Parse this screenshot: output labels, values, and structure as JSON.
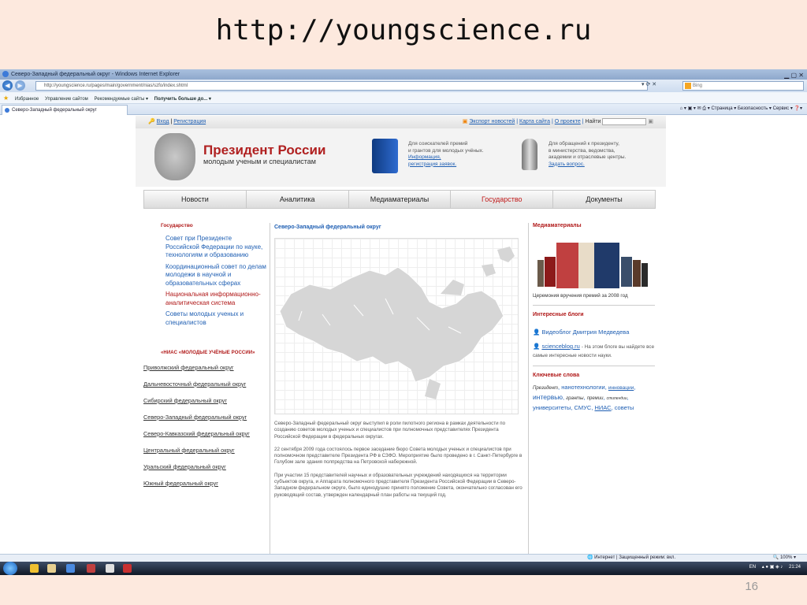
{
  "slide": {
    "title": "http://youngscience.ru",
    "number": "16"
  },
  "browser": {
    "window_title": "Северо-Западный федеральный округ - Windows Internet Explorer",
    "url": "http://youngscience.ru/pages/main/government/nias/szfo/index.shtml",
    "search_placeholder": "Bing",
    "favorites": [
      "Избранное",
      "Управление сайтом",
      "Рекомендуемые сайты ▾",
      "Получить больше до... ▾"
    ],
    "tab_label": "Северо-Западный федеральный округ",
    "commands": [
      "Страница ▾",
      "Безопасность ▾",
      "Сервис ▾"
    ],
    "status": "Интернет | Защищенный режим: вкл.",
    "zoom": "100%"
  },
  "site": {
    "topbar": {
      "login": "Вход",
      "register": "Регистрация",
      "news_export": "Экспорт новостей",
      "sitemap": "Карта сайта",
      "about": "О проекте",
      "find": "Найти"
    },
    "brand": "Президент России",
    "brand_sub": "молодым ученым и специалистам",
    "promo1": [
      "Для соискателей премий",
      "и грантов для молодых учёных."
    ],
    "promo1_links": [
      "Информация,",
      "регистрация заявок."
    ],
    "promo2": [
      "Для обращений к президенту,",
      "в министерства, ведомства,",
      "академии и отраслевые центры."
    ],
    "promo2_link": "Задать вопрос.",
    "menu": [
      "Новости",
      "Аналитика",
      "Медиаматериалы",
      "Государство",
      "Документы"
    ],
    "left": {
      "section": "Государство",
      "subs": [
        "Совет при Президенте Российской Федерации по науке, технологиям и образованию",
        "Координационный совет по делам молодежи в научной и образовательных сферах",
        "Национальная информационно-аналитическая система",
        "Советы молодых ученых и специалистов"
      ],
      "nias": "«НИАС «МОЛОДЫЕ УЧЁНЫЕ РОССИИ»",
      "okrugs": [
        "Приволжский федеральный округ",
        "Дальневосточный федеральный округ",
        "Сибирский федеральный округ",
        "Северо-Западный федеральный округ",
        "Северо-Кавказский федеральный округ",
        "Центральный федеральный округ",
        "Уральский федеральный округ",
        "Южный федеральный округ"
      ]
    },
    "mid": {
      "title": "Северо-Западный федеральный округ",
      "p1": "Северо-Западный федеральный округ выступил в роли пилотного региона в рамках деятельности по созданию советов молодых ученых и специалистов при полномочных представителях Президента Российской Федерации в федеральных округах.",
      "p2": "22 сентября 2009 года состоялось первое заседание бюро Совета молодых ученых и специалистов при полномочном представителе Президента РФ в СЗФО. Мероприятие было проведено в г. Санкт-Петербурге в Голубом зале здания полпредства на Петровской набережной.",
      "p3": "При участии 15 представителей научных и образовательных учреждений находящихся на территории субъектов округа, и Аппарата полномочного представителя Президента Российской Федерации в Северо-Западном федеральном округе, было единодушно принято положение Совета, окончательно согласован его руководящий состав, утвержден календарный план работы на текущий год."
    },
    "right": {
      "media_h": "Медиаматериалы",
      "media_caption": "Церемония вручения премий за 2008 год",
      "blogs_h": "Интересные блоги",
      "blog1": "Видеоблог Дмитрия Медведева",
      "blog2": "scienceblog.ru",
      "blog2_text": "- На этом блоге вы найдете все самые интересные новости науки.",
      "tags_h": "Ключевые слова",
      "tags": [
        "Президент",
        "нанотехнологии",
        "инновации",
        "интервью",
        "гранты",
        "премии",
        "стипендии",
        "университеты",
        "СМУС",
        "НИАС",
        "советы"
      ]
    }
  },
  "taskbar": {
    "lang": "EN",
    "time": "21:24"
  }
}
